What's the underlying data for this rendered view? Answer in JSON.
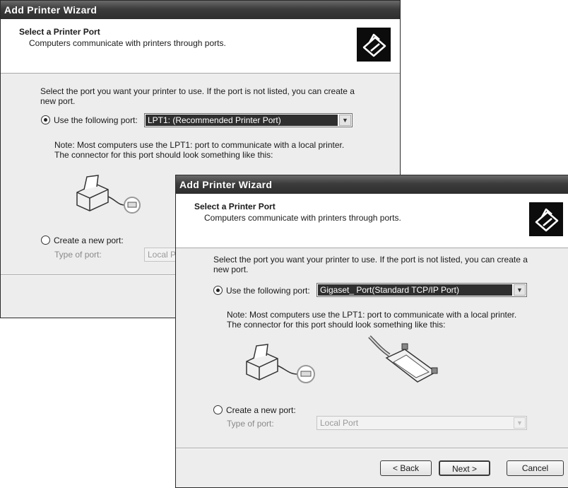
{
  "back_window": {
    "title": "Add Printer Wizard",
    "header_title": "Select a Printer Port",
    "header_subtitle": "Computers communicate with printers through ports.",
    "instruction": "Select the port you want your printer to use.  If the port is not listed, you can create a new port.",
    "use_port_label": "Use the following port:",
    "selected_port": "LPT1: (Recommended Printer Port)",
    "note": "Note: Most computers use the LPT1: port to communicate with a local printer. The connector for this port should look something like this:",
    "create_port_label": "Create a new port:",
    "type_of_port_label": "Type of port:",
    "type_of_port_value": "Local Port"
  },
  "front_window": {
    "title": "Add Printer Wizard",
    "header_title": "Select a Printer Port",
    "header_subtitle": "Computers communicate with printers through ports.",
    "instruction": "Select the port you want your printer to use.  If the port is not listed, you can create a new port.",
    "use_port_label": "Use the following port:",
    "selected_port": "Gigaset_ Port(Standard TCP/IP Port)",
    "note": "Note: Most computers use the LPT1: port to communicate with a local printer. The connector for this port should look something like this:",
    "create_port_label": "Create a new port:",
    "type_of_port_label": "Type of port:",
    "type_of_port_value": "Local Port",
    "buttons": {
      "back": "< Back",
      "next": "Next >",
      "cancel": "Cancel"
    }
  },
  "icons": [
    "printer-wizard-icon",
    "printer-illustration",
    "parallel-cable-illustration",
    "dropdown-arrow-icon"
  ]
}
